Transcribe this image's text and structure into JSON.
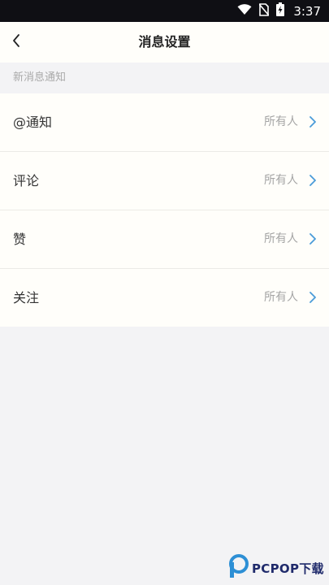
{
  "status_bar": {
    "time": "3:37",
    "icons": [
      "wifi-icon",
      "no-sim-icon",
      "battery-charging-icon"
    ]
  },
  "header": {
    "title": "消息设置",
    "back_icon": "chevron-left-icon"
  },
  "section": {
    "label": "新消息通知"
  },
  "settings": [
    {
      "label": "@通知",
      "value": "所有人"
    },
    {
      "label": "评论",
      "value": "所有人"
    },
    {
      "label": "赞",
      "value": "所有人"
    },
    {
      "label": "关注",
      "value": "所有人"
    }
  ],
  "watermark": {
    "text": "PCPOP下载"
  },
  "colors": {
    "chevron": "#4a9bd8",
    "page_background": "#f3f3f5",
    "card_background": "#fffefa",
    "status_bar": "#0f0f14"
  }
}
